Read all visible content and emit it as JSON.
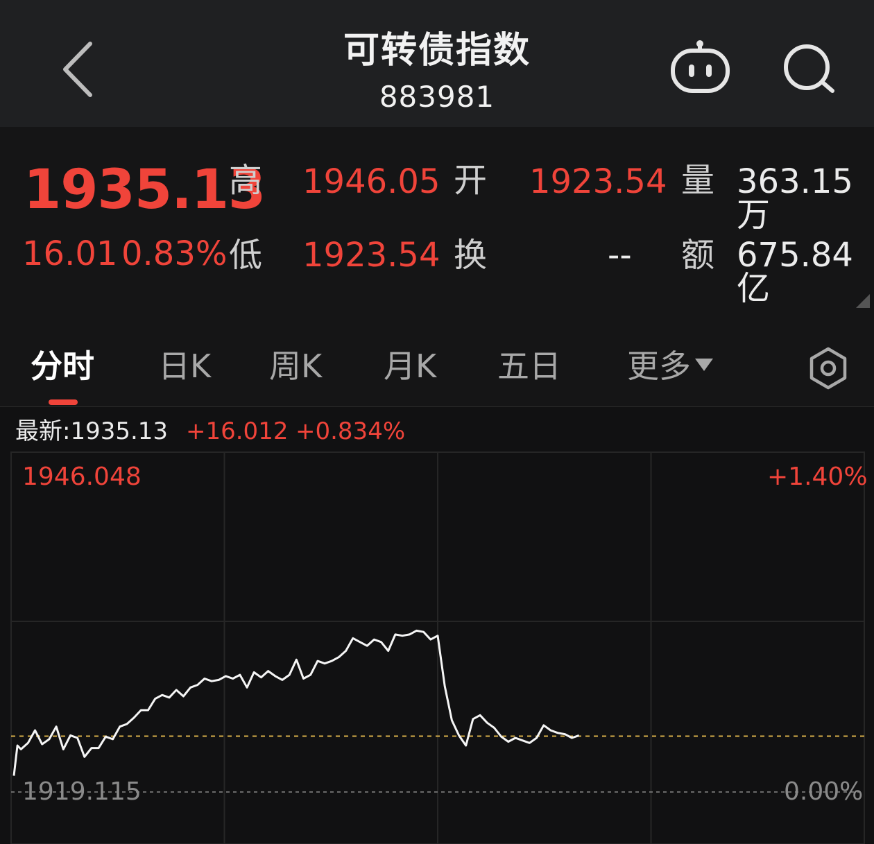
{
  "header": {
    "title": "可转债指数",
    "code": "883981",
    "icons": [
      "back-chevron-icon",
      "robot-assistant-icon",
      "search-icon"
    ]
  },
  "quote": {
    "price": "1935.13",
    "change": "16.01",
    "change_pct": "0.83%",
    "high_label": "高",
    "high": "1946.05",
    "open_label": "开",
    "open": "1923.54",
    "volume_label": "量",
    "volume": "363.15万",
    "low_label": "低",
    "low": "1923.54",
    "turnover_label": "换",
    "turnover": "--",
    "amount_label": "额",
    "amount": "675.84亿"
  },
  "tabs": {
    "items": [
      "分时",
      "日K",
      "周K",
      "月K",
      "五日",
      "更多"
    ],
    "active": "分时",
    "settings_icon": "settings-hexagon-icon"
  },
  "chart_info": {
    "latest_label": "最新:1935.13",
    "latest_change": "+16.012",
    "latest_pct": "+0.834%",
    "y_max": "1946.048",
    "y_min": "1919.115",
    "pct_max": "+1.40%",
    "pct_min": "0.00%"
  },
  "colors": {
    "up": "#f0443a",
    "background": "#111112",
    "header": "#1f2022",
    "line": "#f5f5f5",
    "baseline": "#d8b04a"
  },
  "chart_data": {
    "type": "line",
    "title": "",
    "ylim": [
      1919.115,
      1946.048
    ],
    "prev_close": 1923.54,
    "x_slots": 241,
    "x": [
      0,
      1,
      2,
      4,
      6,
      8,
      10,
      12,
      14,
      16,
      18,
      20,
      22,
      24,
      26,
      28,
      30,
      32,
      34,
      36,
      38,
      40,
      42,
      44,
      46,
      48,
      50,
      52,
      54,
      56,
      58,
      60,
      62,
      64,
      66,
      68,
      70,
      72,
      74,
      76,
      78,
      80,
      82,
      84,
      86,
      88,
      90,
      92,
      94,
      96,
      98,
      100,
      102,
      104,
      106,
      108,
      110,
      112,
      114,
      116,
      118,
      120,
      122,
      124,
      126,
      128,
      130,
      132,
      134,
      136,
      138,
      140,
      142,
      144,
      146,
      148,
      150,
      152,
      154,
      156,
      158,
      160
    ],
    "values": [
      1920.4,
      1922.8,
      1922.5,
      1923.0,
      1924.0,
      1922.9,
      1923.3,
      1924.3,
      1922.5,
      1923.6,
      1923.4,
      1921.9,
      1922.6,
      1922.6,
      1923.5,
      1923.3,
      1924.3,
      1924.5,
      1925.0,
      1925.6,
      1925.6,
      1926.5,
      1926.8,
      1926.6,
      1927.2,
      1926.7,
      1927.4,
      1927.6,
      1928.1,
      1927.9,
      1928.0,
      1928.3,
      1928.1,
      1928.4,
      1927.4,
      1928.6,
      1928.2,
      1928.7,
      1928.3,
      1928.0,
      1928.4,
      1929.6,
      1928.1,
      1928.4,
      1929.5,
      1929.3,
      1929.5,
      1929.8,
      1930.3,
      1931.3,
      1931.0,
      1930.7,
      1931.2,
      1931.0,
      1930.3,
      1931.6,
      1931.5,
      1931.6,
      1931.9,
      1931.8,
      1931.2,
      1931.5,
      1927.5,
      1924.8,
      1923.6,
      1922.8,
      1924.9,
      1925.2,
      1924.6,
      1924.2,
      1923.5,
      1923.1,
      1923.4,
      1923.2,
      1923.0,
      1923.4,
      1924.4,
      1924.0,
      1923.8,
      1923.7,
      1923.4,
      1923.6
    ]
  }
}
